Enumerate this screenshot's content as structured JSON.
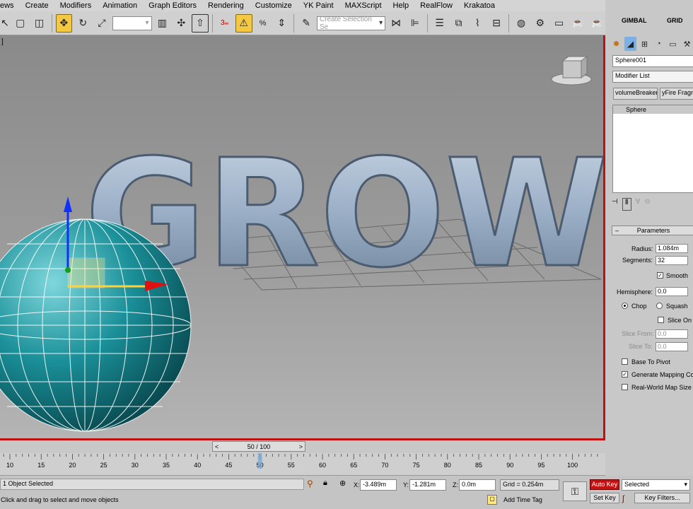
{
  "menus": [
    "ews",
    "Create",
    "Modifiers",
    "Animation",
    "Graph Editors",
    "Rendering",
    "Customize",
    "YK Paint",
    "MAXScript",
    "Help",
    "RealFlow",
    "Krakatoa"
  ],
  "toolbar": {
    "selection_set_placeholder": "Create Selection Se",
    "snap_label": "3"
  },
  "right_panel": {
    "tab_gimbal": "GIMBAL",
    "tab_grid": "GRID",
    "object_name": "Sphere001",
    "modifier_list_label": "Modifier List",
    "button_volumebreaker": "volumeBreaker",
    "button_fragment": "yFire Fragm",
    "stack_item": "Sphere",
    "parameters_title": "Parameters",
    "radius_label": "Radius:",
    "radius_value": "1.084m",
    "segments_label": "Segments:",
    "segments_value": "32",
    "smooth_label": "Smooth",
    "hemisphere_label": "Hemisphere:",
    "hemisphere_value": "0.0",
    "chop_label": "Chop",
    "squash_label": "Squash",
    "slice_on_label": "Slice On",
    "slice_from_label": "Slice From:",
    "slice_from_value": "0.0",
    "slice_to_label": "Slice To:",
    "slice_to_value": "0.0",
    "base_to_pivot_label": "Base To Pivot",
    "generate_mapping_label": "Generate Mapping Co",
    "real_world_label": "Real-World Map Size"
  },
  "viewport": {
    "corner_label": "]",
    "scene_text": "GROW",
    "accent_border": "#c01010",
    "sphere_color": "#1a8f98"
  },
  "timeline": {
    "frame_counter": "50 / 100",
    "ticks": [
      "10",
      "15",
      "20",
      "25",
      "30",
      "35",
      "40",
      "45",
      "50",
      "55",
      "60",
      "65",
      "70",
      "75",
      "80",
      "85",
      "90",
      "95",
      "100"
    ],
    "current_frame": 50,
    "total_frames": 100
  },
  "status": {
    "objects_selected": "1 Object Selected",
    "prompt": "Click and drag to select and move objects",
    "x_label": "X:",
    "x_value": "-3.489m",
    "y_label": "Y:",
    "y_value": "-1.281m",
    "z_label": "Z:",
    "z_value": "0.0m",
    "grid": "Grid = 0.254m",
    "add_time_tag": "Add Time Tag",
    "auto_key": "Auto Key",
    "set_key": "Set Key",
    "selected_dropdown": "Selected",
    "key_filters": "Key Filters..."
  }
}
